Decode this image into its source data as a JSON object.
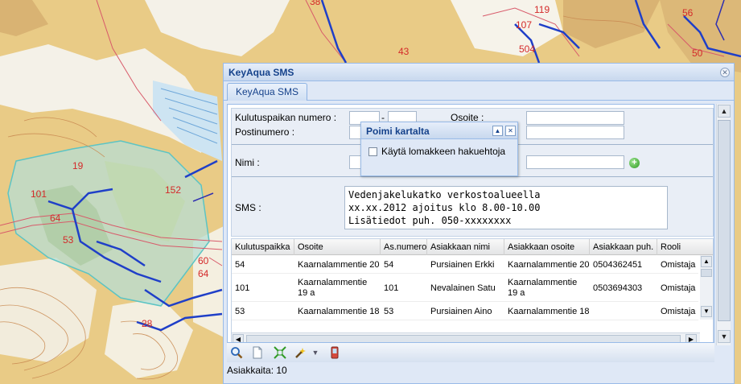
{
  "map": {
    "labels": [
      "38",
      "119",
      "107",
      "504",
      "43",
      "56",
      "50",
      "19",
      "101",
      "64",
      "53",
      "152",
      "60",
      "28",
      "64"
    ]
  },
  "window": {
    "title": "KeyAqua SMS",
    "tab_label": "KeyAqua SMS"
  },
  "form": {
    "kulutuspaikka_label": "Kulutuspaikan numero :",
    "range_dash": "-",
    "osoite_label": "Osoite :",
    "postinumero_label": "Postinumero :",
    "nimi_label": "Nimi :",
    "sms_label": "SMS :",
    "sms_text": "Vedenjakelukatko verkostoalueella\nxx.xx.2012 ajoitus klo 8.00-10.00\nLisätiedot puh. 050-xxxxxxxx"
  },
  "popup": {
    "title": "Poimi kartalta",
    "checkbox_label": "Käytä lomakkeen hakuehtoja"
  },
  "grid": {
    "columns": [
      "Kulutuspaikka",
      "Osoite",
      "As.numero",
      "Asiakkaan nimi",
      "Asiakkaan osoite",
      "Asiakkaan puh.",
      "Rooli"
    ],
    "rows": [
      [
        "54",
        "Kaarnalammentie 20",
        "54",
        "Pursiainen Erkki",
        "Kaarnalammentie 20",
        "0504362451",
        "Omistaja"
      ],
      [
        "101",
        "Kaarnalammentie 19 a",
        "101",
        "Nevalainen Satu",
        "Kaarnalammentie 19 a",
        "0503694303",
        "Omistaja"
      ],
      [
        "53",
        "Kaarnalammentie 18",
        "53",
        "Pursiainen Aino",
        "Kaarnalammentie 18",
        "",
        "Omistaja"
      ]
    ]
  },
  "status": {
    "text": "Asiakkaita: 10"
  },
  "icons": {
    "search": "magnifier-icon",
    "new": "document-icon",
    "select": "select-area-icon",
    "tool": "wand-icon",
    "sms": "phone-icon"
  }
}
